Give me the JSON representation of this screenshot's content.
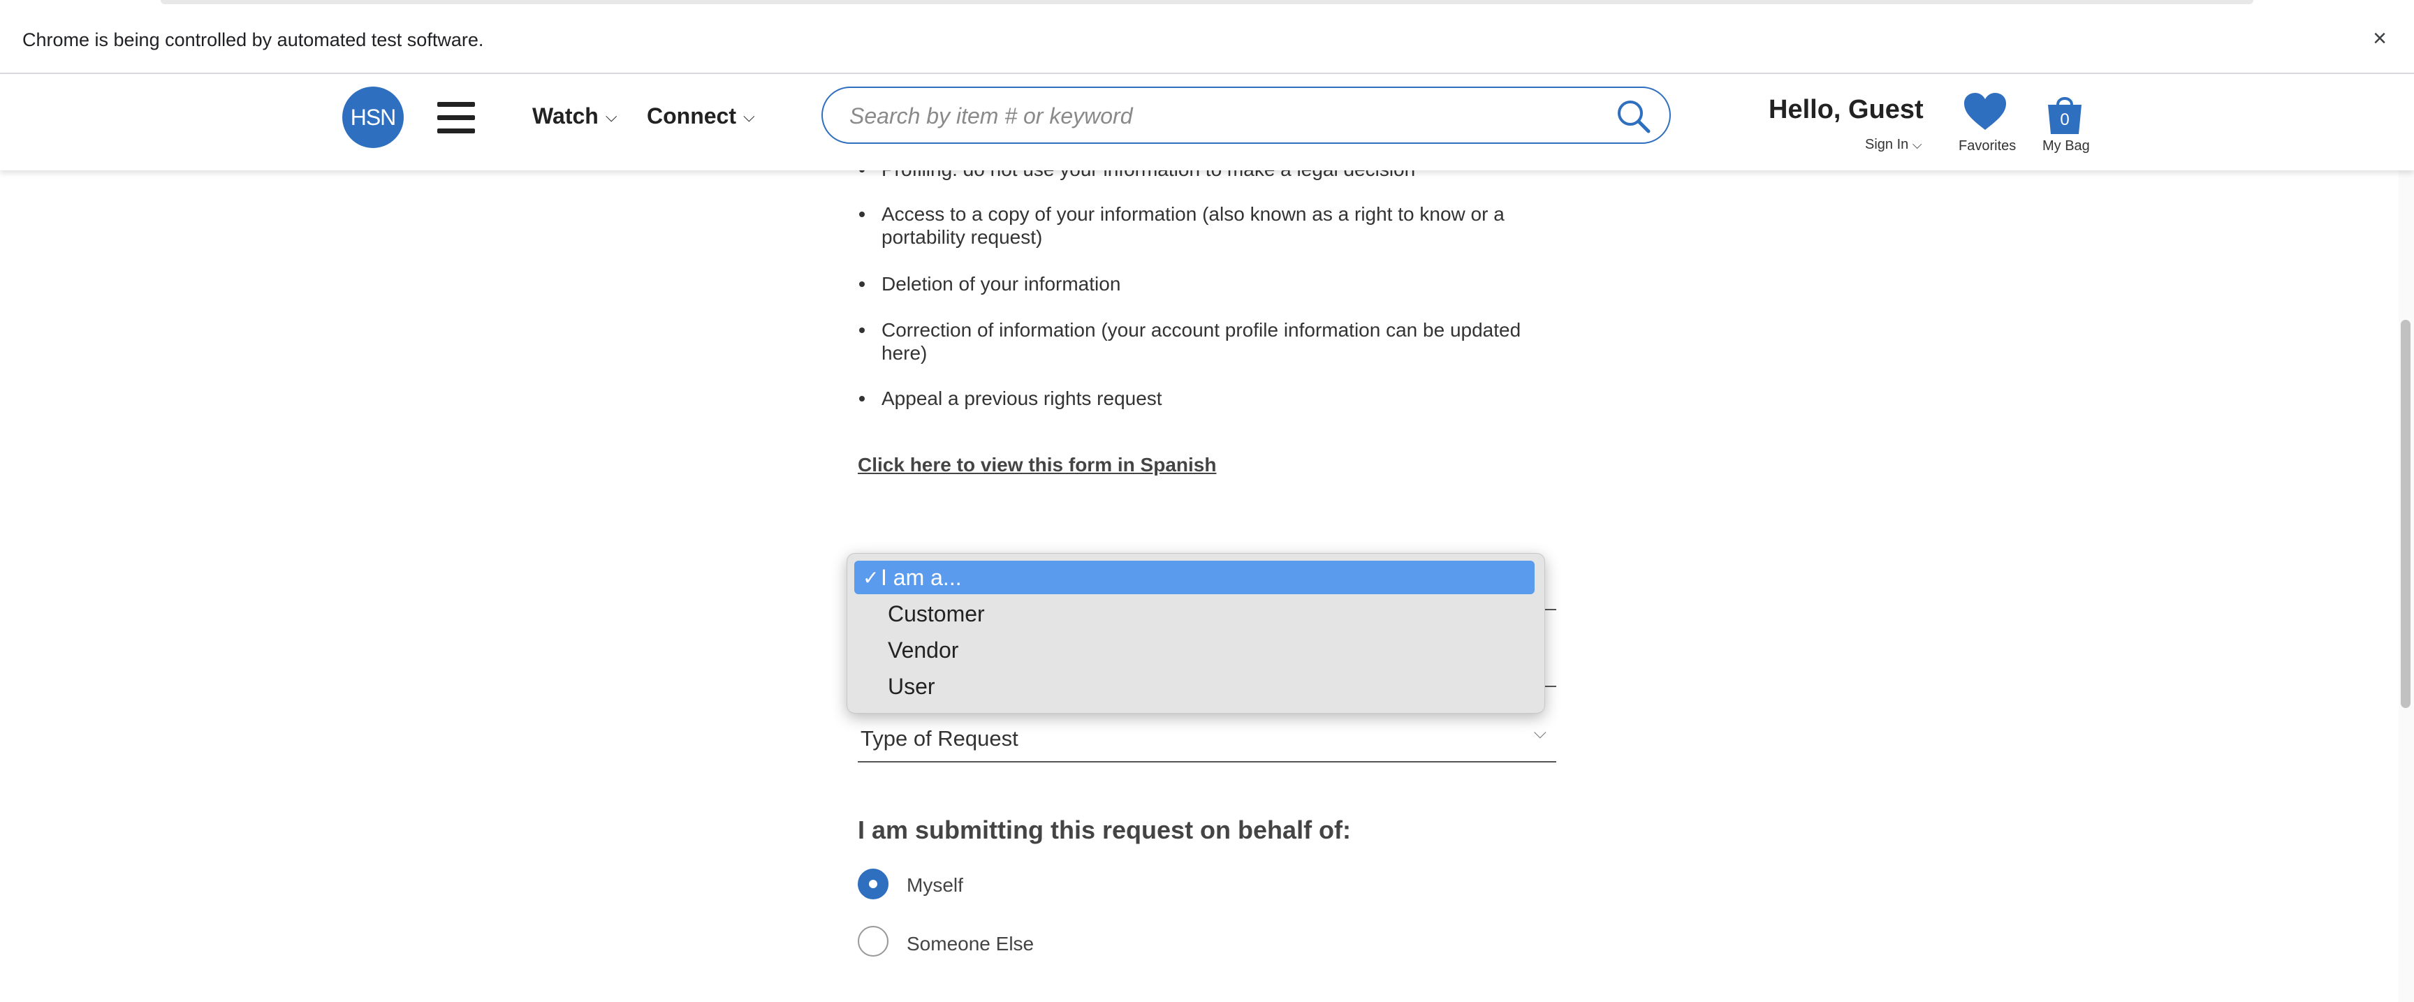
{
  "infobar": {
    "message": "Chrome is being controlled by automated test software.",
    "close_glyph": "×"
  },
  "header": {
    "logo_text": "HSN",
    "nav": [
      {
        "label": "Watch"
      },
      {
        "label": "Connect"
      }
    ],
    "search": {
      "placeholder": "Search by item # or keyword",
      "value": ""
    },
    "greeting": "Hello, Guest",
    "sign_in": "Sign In",
    "favorites_label": "Favorites",
    "bag_count": "0",
    "bag_label": "My Bag"
  },
  "content": {
    "cut_bullet": "Profiling: do not use your information to make a legal decision",
    "bullets": [
      "Access to a copy of your information (also known as a right to know or a portability request)",
      "Deletion of your information",
      "Correction of information (your account profile information can be updated here)",
      "Appeal a previous rights request"
    ],
    "spanish_link": "Click here to view this form in Spanish",
    "type_of_request": "Type of Request",
    "behalf_heading": "I am submitting this request on behalf of:",
    "radios": [
      {
        "label": "Myself",
        "checked": true
      },
      {
        "label": "Someone Else",
        "checked": false
      }
    ]
  },
  "dropdown": {
    "options": [
      {
        "label": "I am a...",
        "selected": true
      },
      {
        "label": "Customer",
        "selected": false
      },
      {
        "label": "Vendor",
        "selected": false
      },
      {
        "label": "User",
        "selected": false
      }
    ],
    "check_glyph": "✓"
  },
  "colors": {
    "brand_blue": "#2f6fbf",
    "selected_option": "#5b9bed"
  }
}
